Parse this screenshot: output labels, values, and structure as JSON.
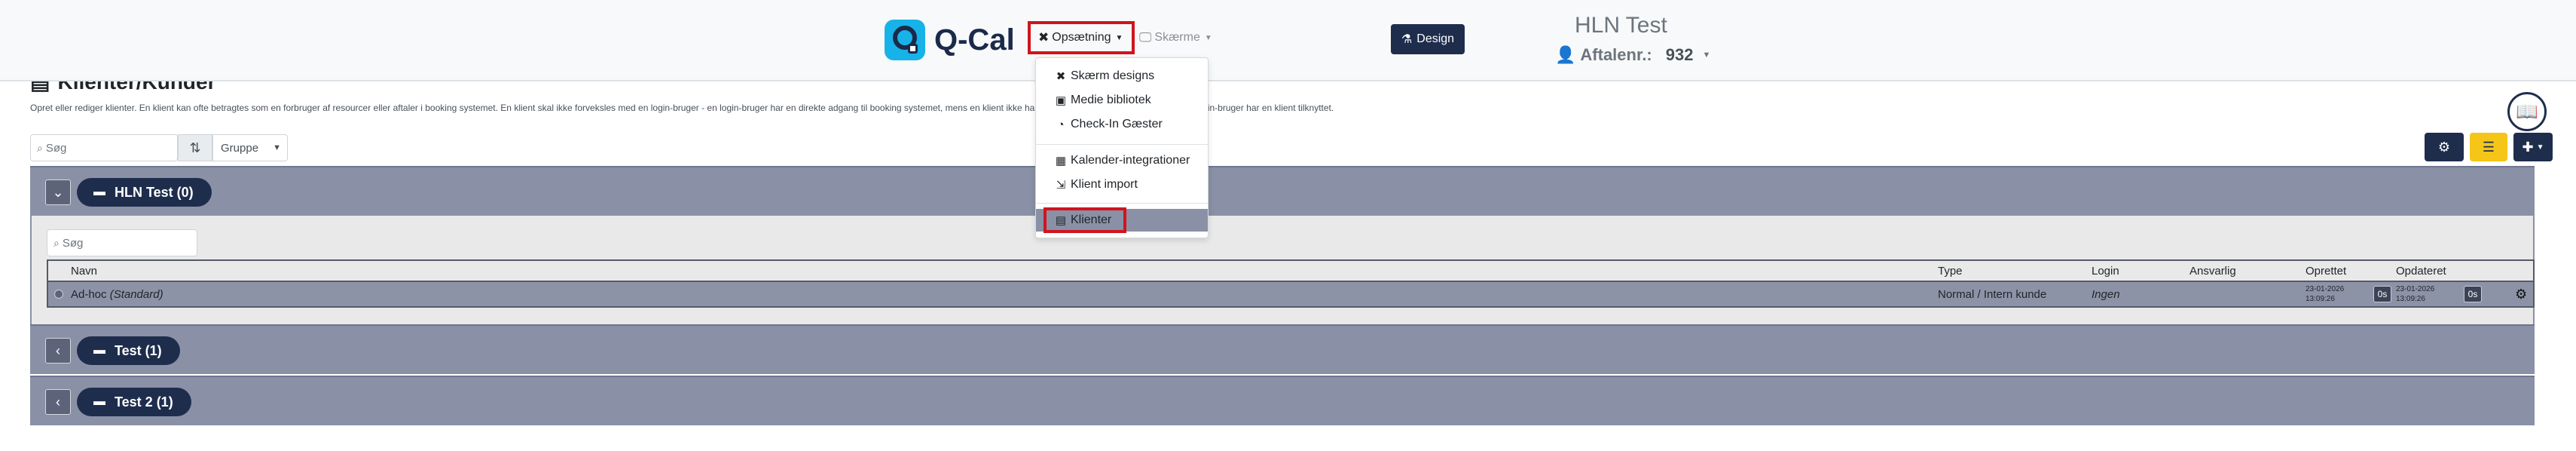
{
  "navbar": {
    "logo_text": "Q-Cal",
    "opsaetning_label": "Opsætning",
    "skaerme_label": "Skærme",
    "design_label": "Design",
    "company_name": "HLN Test",
    "aftale_label": "Aftalenr.:",
    "aftale_number": "932"
  },
  "dropdown": {
    "items": [
      {
        "label": "Skærm designs",
        "icon": "wrench-screwdriver-icon"
      },
      {
        "label": "Medie bibliotek",
        "icon": "images-icon"
      },
      {
        "label": "Check-In Gæster",
        "icon": "gauge-icon"
      },
      {
        "label": "Kalender-integrationer",
        "icon": "calendar-plus-icon"
      },
      {
        "label": "Klient import",
        "icon": "file-import-icon"
      },
      {
        "label": "Klienter",
        "icon": "address-book-icon"
      }
    ]
  },
  "page": {
    "title": "Klienter/Kunder",
    "description": "Opret eller rediger klienter. En klient kan ofte betragtes som en forbruger af resourcer eller aftaler i booking systemet. En klient skal ikke forveksles med en login-bruger - en login-bruger har en direkte adgang til booking systemet, mens en klient ikke har. Det er dog ganske ofte tilfældet, at en login-bruger har en klient tilknyttet."
  },
  "toolbar": {
    "search_placeholder": "Søg",
    "group_select": "Gruppe"
  },
  "groups": [
    {
      "label": "HLN Test (0)",
      "expanded": true
    },
    {
      "label": "Test (1)",
      "expanded": false
    },
    {
      "label": "Test 2 (1)",
      "expanded": false
    }
  ],
  "inner": {
    "search_placeholder": "Søg"
  },
  "table": {
    "headers": {
      "navn": "Navn",
      "type": "Type",
      "login": "Login",
      "ansvarlig": "Ansvarlig",
      "oprettet": "Oprettet",
      "opdateret": "Opdateret"
    },
    "rows": [
      {
        "navn": "Ad-hoc",
        "navn_suffix": "(Standard)",
        "type": "Normal / Intern kunde",
        "login": "Ingen",
        "ansvarlig": "",
        "oprettet_date": "23-01-2026",
        "oprettet_time": "13:09:26",
        "oprettet_badge": "0s",
        "opdateret_date": "23-01-2026",
        "opdateret_time": "13:09:26",
        "opdateret_badge": "0s"
      }
    ]
  },
  "colors": {
    "brand_navy": "#1f2d4d",
    "accent_yellow": "#f5c518",
    "group_bg": "#8a91a6",
    "highlight_red": "#d0141e",
    "logo_blue": "#17b3e8"
  }
}
